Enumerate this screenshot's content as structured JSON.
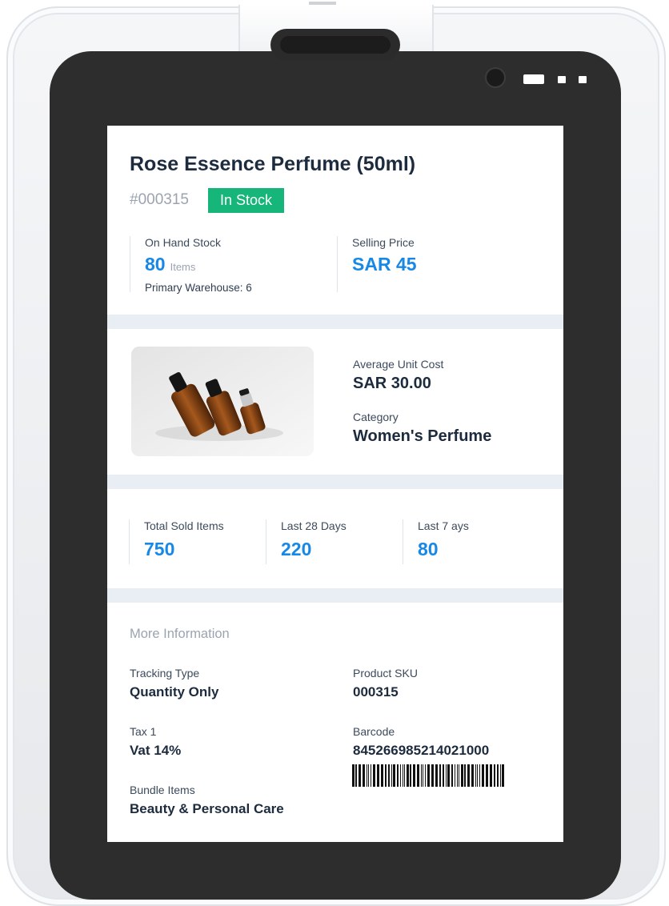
{
  "product": {
    "title": "Rose Essence Perfume (50ml)",
    "id": "#000315",
    "status": "In Stock",
    "status_color": "#16b57a"
  },
  "stock": {
    "on_hand_label": "On Hand Stock",
    "on_hand_value": "80",
    "on_hand_unit": "Items",
    "warehouse_text": "Primary Warehouse: 6",
    "selling_price_label": "Selling Price",
    "selling_price_value": "SAR 45"
  },
  "details": {
    "image_icon": "perfume-bottles-photo",
    "avg_cost_label": "Average Unit Cost",
    "avg_cost_value": "SAR 30.00",
    "category_label": "Category",
    "category_value": "Women's Perfume"
  },
  "sales": {
    "total_label": "Total Sold Items",
    "total_value": "750",
    "last28_label": "Last 28 Days",
    "last28_value": "220",
    "last7_label": "Last 7 ays",
    "last7_value": "80"
  },
  "more": {
    "section_title": "More Information",
    "tracking_label": "Tracking Type",
    "tracking_value": "Quantity Only",
    "sku_label": "Product SKU",
    "sku_value": "000315",
    "tax_label": "Tax 1",
    "tax_value": "Vat 14%",
    "barcode_label": "Barcode",
    "barcode_value": "845266985214021000",
    "bundle_label": "Bundle Items",
    "bundle_value": "Beauty & Personal Care"
  },
  "colors": {
    "accent_blue": "#1788e6",
    "heading": "#1c2b3e",
    "muted": "#9aa4b0"
  }
}
